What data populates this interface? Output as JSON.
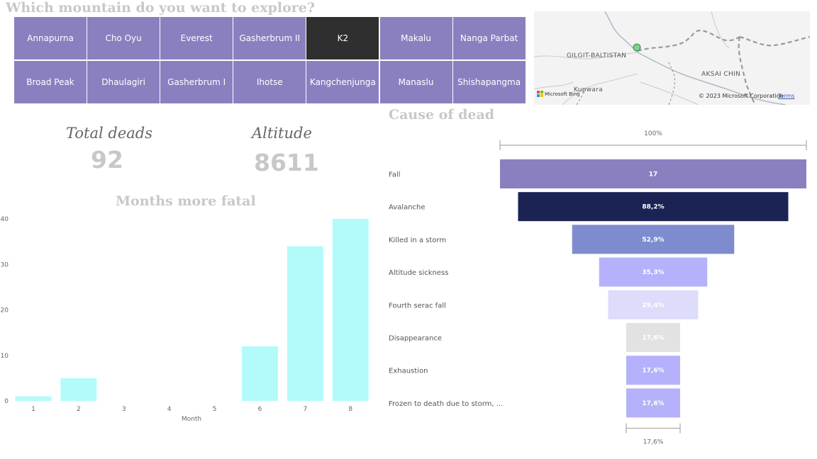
{
  "header": {
    "title": "Which mountain do you want to explore?"
  },
  "slicer": {
    "selected": "K2",
    "selected_color": "#2f2f2f",
    "tile_color": "#8a80c0",
    "rows": [
      [
        "Annapurna",
        "Cho Oyu",
        "Everest",
        "Gasherbrum II",
        "K2",
        "Makalu",
        "Nanga Parbat"
      ],
      [
        "Broad Peak",
        "Dhaulagiri",
        "Gasherbrum I",
        "Ihotse",
        "Kangchenjunga",
        "Manaslu",
        "Shishapangma"
      ]
    ]
  },
  "map": {
    "labels": {
      "region1": "GILGIT-BALTISTAN",
      "region2": "AKSAI CHIN",
      "town": "Kupwara"
    },
    "attribution": {
      "brand": "Microsoft Bing",
      "copyright": "© 2023 Microsoft Corporation",
      "terms": "Terms"
    },
    "marker_color": "#7dd08a"
  },
  "kpis": {
    "total_deads": {
      "label": "Total deads",
      "value": "92"
    },
    "altitude": {
      "label": "Altitude",
      "value": "8611"
    }
  },
  "months_chart": {
    "title": "Months more fatal"
  },
  "funnel_chart": {
    "title": "Cause of dead"
  },
  "chart_data": [
    {
      "type": "bar",
      "title": "Months more fatal",
      "xlabel": "Month",
      "ylabel": "",
      "categories": [
        "1",
        "2",
        "3",
        "4",
        "5",
        "6",
        "7",
        "8"
      ],
      "values": [
        1,
        5,
        0,
        0,
        0,
        12,
        34,
        40
      ],
      "ylim": [
        0,
        40
      ],
      "yticks": [
        "0",
        "10",
        "20",
        "30",
        "40"
      ],
      "bar_color": "#b3fbfb",
      "grid": false
    },
    {
      "type": "funnel",
      "title": "Cause of dead",
      "top_label": "100%",
      "bottom_label": "17,6%",
      "categories": [
        "Fall",
        "Avalanche",
        "Killed in a storm",
        "Altitude sickness",
        "Fourth serac fall",
        "Disappearance",
        "Exhaustion",
        "Frozen to death due to storm, ..."
      ],
      "fractions": [
        1.0,
        0.882,
        0.529,
        0.353,
        0.294,
        0.176,
        0.176,
        0.176
      ],
      "value_labels": [
        "17",
        "88,2%",
        "52,9%",
        "35,3%",
        "29,4%",
        "17,6%",
        "17,6%",
        "17,6%"
      ],
      "colors": [
        "#8a80c0",
        "#1b2354",
        "#7e8ccf",
        "#b5b2fb",
        "#dedcfb",
        "#e2e2e2",
        "#b5b2fb",
        "#b5b2fb"
      ]
    }
  ]
}
